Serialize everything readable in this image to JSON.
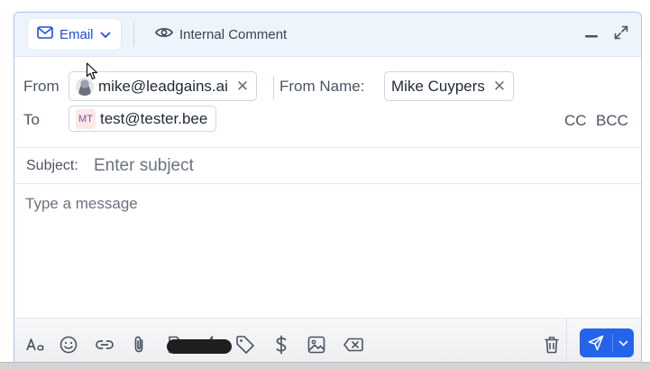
{
  "header": {
    "email_tab_label": "Email",
    "internal_comment_label": "Internal Comment"
  },
  "from": {
    "label": "From",
    "email": "mike@leadgains.ai",
    "name_label": "From Name:",
    "name": "Mike Cuypers"
  },
  "to": {
    "label": "To",
    "recipient_initials": "MT",
    "recipient_email": "test@tester.bee",
    "cc_label": "CC",
    "bcc_label": "BCC"
  },
  "subject": {
    "label": "Subject:",
    "placeholder": "Enter subject"
  },
  "message": {
    "placeholder": "Type a message"
  },
  "toolbar": {
    "icons": [
      "text-format-icon",
      "emoji-icon",
      "link-icon",
      "attachment-icon",
      "document-icon",
      "lightning-icon",
      "tag-icon",
      "dollar-icon",
      "image-icon",
      "clear-format-icon",
      "trash-icon",
      "send-icon",
      "chevron-down-icon"
    ]
  },
  "colors": {
    "accent": "#2563eb",
    "header_bg": "#eef4fc",
    "border": "#a9c4ea"
  }
}
